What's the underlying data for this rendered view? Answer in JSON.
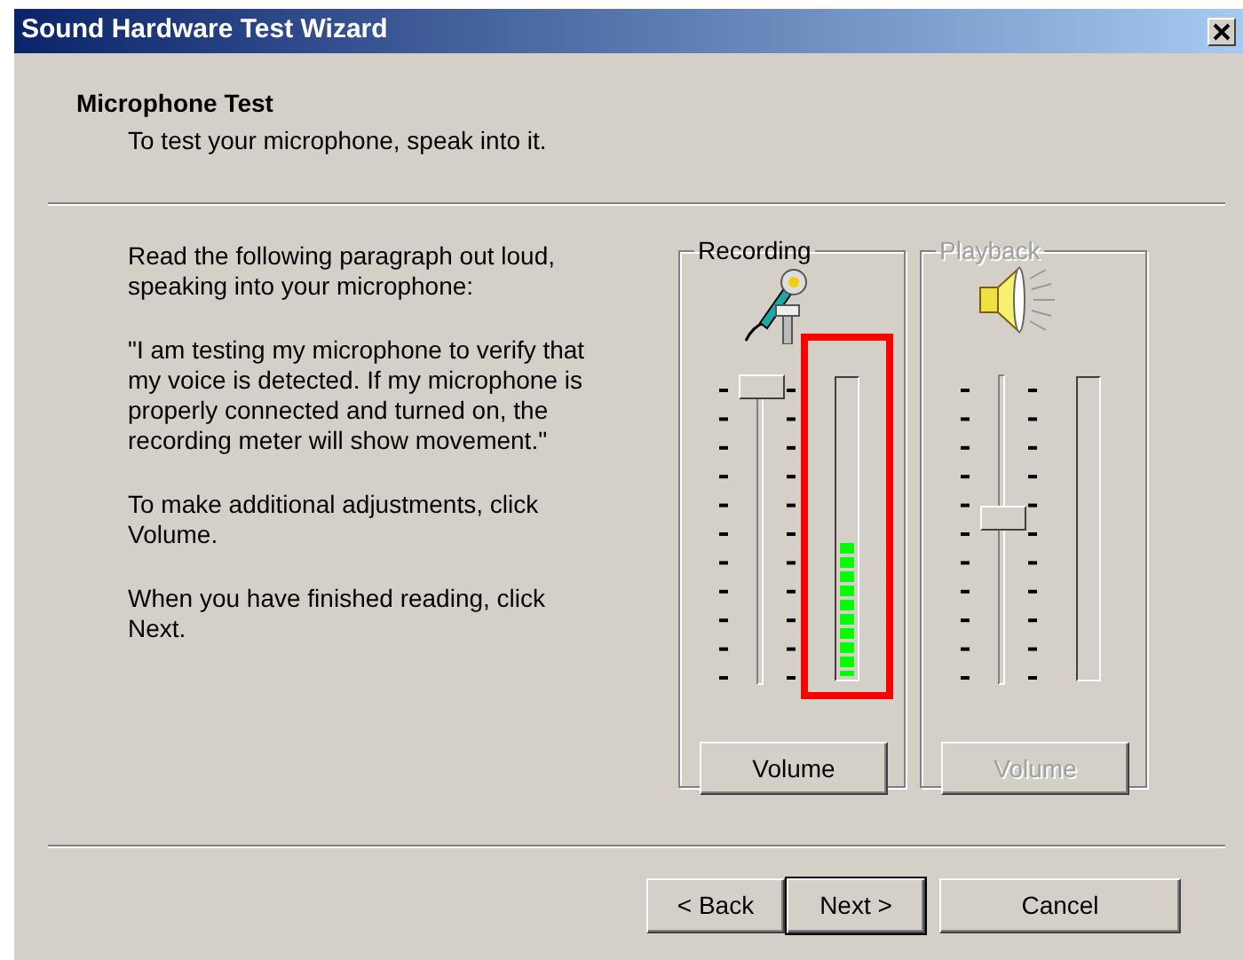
{
  "window": {
    "title": "Sound Hardware Test Wizard"
  },
  "header": {
    "title": "Microphone Test",
    "subtitle": "To test your microphone, speak into it."
  },
  "instructions": [
    "Read the following paragraph out loud, speaking into your microphone:",
    "\"I am testing my microphone to verify that my voice is detected. If my microphone is properly connected and turned on, the recording meter will show movement.\"",
    "To make additional adjustments, click Volume.",
    "When you have finished reading, click Next."
  ],
  "groups": [
    {
      "label": "Recording",
      "kind": "microphone",
      "disabled": false,
      "slider": {
        "level": 1.0
      },
      "meter": {
        "level": 0.45,
        "highlighted": true
      },
      "button": "Volume"
    },
    {
      "label": "Playback",
      "kind": "speaker",
      "disabled": true,
      "slider": {
        "level": 0.54
      },
      "meter": {
        "highlighted": false
      },
      "button": "Volume"
    }
  ],
  "buttons": [
    {
      "label": "< Back",
      "default": false
    },
    {
      "label": "Next >",
      "default": true
    },
    {
      "label": "Cancel",
      "default": false
    }
  ]
}
